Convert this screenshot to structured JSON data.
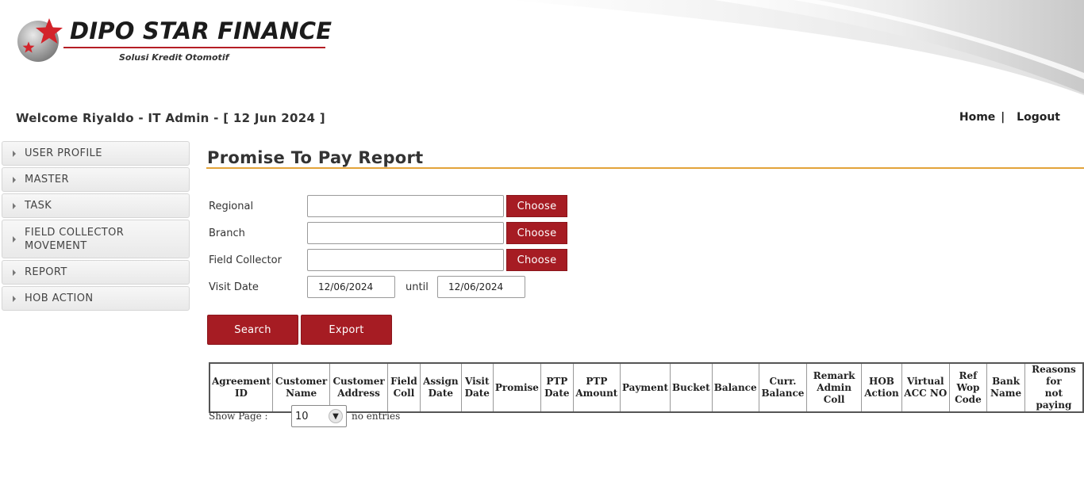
{
  "brand": {
    "name": "DIPO STAR FINANCE",
    "tagline": "Solusi Kredit Otomotif"
  },
  "header": {
    "welcome": "Welcome Riyaldo - IT Admin - [ 12 Jun 2024 ]",
    "home_link": "Home",
    "separator": "|",
    "logout_link": "Logout"
  },
  "sidebar": {
    "items": [
      {
        "label": "USER PROFILE"
      },
      {
        "label": "MASTER"
      },
      {
        "label": "TASK"
      },
      {
        "label": "FIELD COLLECTOR MOVEMENT"
      },
      {
        "label": "REPORT"
      },
      {
        "label": "HOB ACTION"
      }
    ]
  },
  "page": {
    "title": "Promise To Pay Report"
  },
  "form": {
    "regional_label": "Regional",
    "branch_label": "Branch",
    "field_collector_label": "Field Collector",
    "visit_date_label": "Visit Date",
    "choose_label": "Choose",
    "regional_value": "",
    "branch_value": "",
    "field_collector_value": "",
    "visit_date_from": "12/06/2024",
    "until_label": "until",
    "visit_date_to": "12/06/2024",
    "search_label": "Search",
    "export_label": "Export"
  },
  "table": {
    "columns": [
      [
        "Agreement",
        "ID"
      ],
      [
        "Customer",
        "Name"
      ],
      [
        "Customer",
        "Address"
      ],
      [
        "Field",
        "Coll"
      ],
      [
        "Assign",
        "Date"
      ],
      [
        "Visit",
        "Date"
      ],
      [
        "Promise",
        ""
      ],
      [
        "PTP",
        "Date"
      ],
      [
        "PTP",
        "Amount"
      ],
      [
        "Payment",
        ""
      ],
      [
        "Bucket",
        ""
      ],
      [
        "Balance",
        ""
      ],
      [
        "Curr.",
        "Balance"
      ],
      [
        "Remark",
        "Admin Coll"
      ],
      [
        "HOB",
        "Action"
      ],
      [
        "Virtual",
        "ACC NO"
      ],
      [
        "Ref Wop",
        "Code"
      ],
      [
        "Bank",
        "Name"
      ],
      [
        "Reasons for",
        "not paying"
      ]
    ]
  },
  "pagination": {
    "show_page_label": "Show Page :",
    "page_size": "10",
    "entries_text": "no entries"
  },
  "colors": {
    "primary_red": "#a61c23",
    "title_rule": "#e3a33a"
  }
}
